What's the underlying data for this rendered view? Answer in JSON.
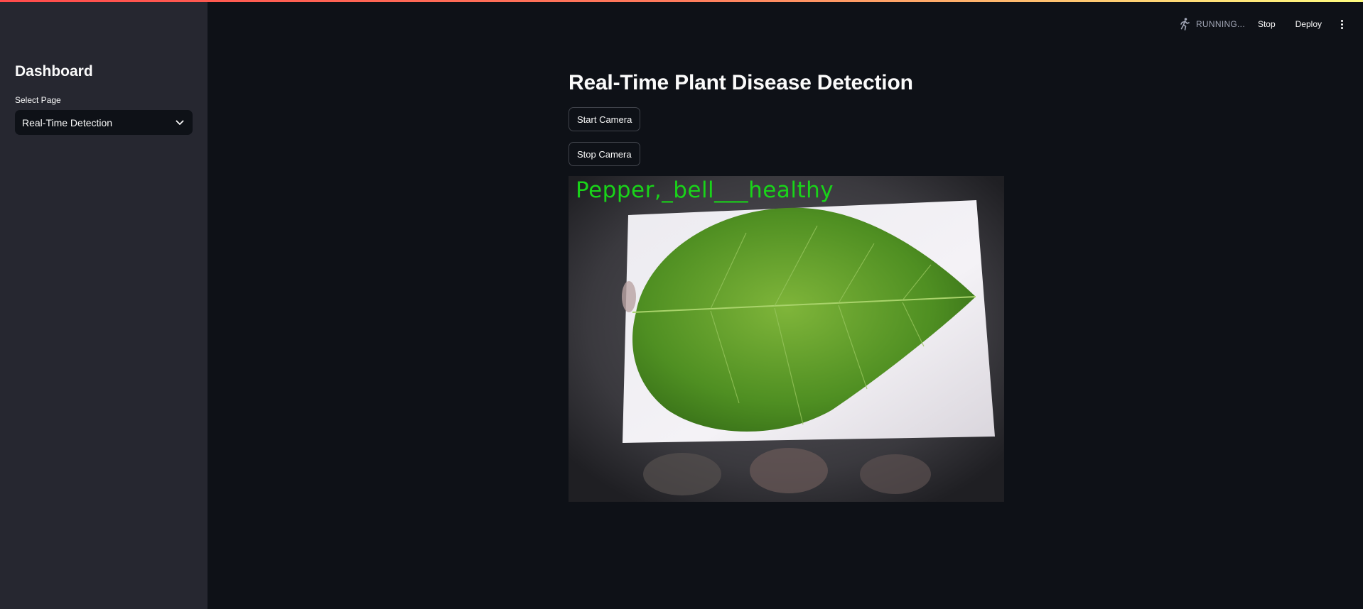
{
  "sidebar": {
    "title": "Dashboard",
    "select_label": "Select Page",
    "select_value": "Real-Time Detection"
  },
  "header": {
    "status": "RUNNING...",
    "stop_label": "Stop",
    "deploy_label": "Deploy",
    "running_icon": "running-man-icon",
    "menu_icon": "kebab-menu-icon"
  },
  "main": {
    "title": "Real-Time Plant Disease Detection",
    "start_button": "Start Camera",
    "stop_button": "Stop Camera",
    "prediction_label": "Pepper,_bell___healthy"
  },
  "colors": {
    "accent": "#ff4b4b",
    "background": "#0e1117",
    "sidebar": "#262730",
    "prediction": "#19d419"
  }
}
